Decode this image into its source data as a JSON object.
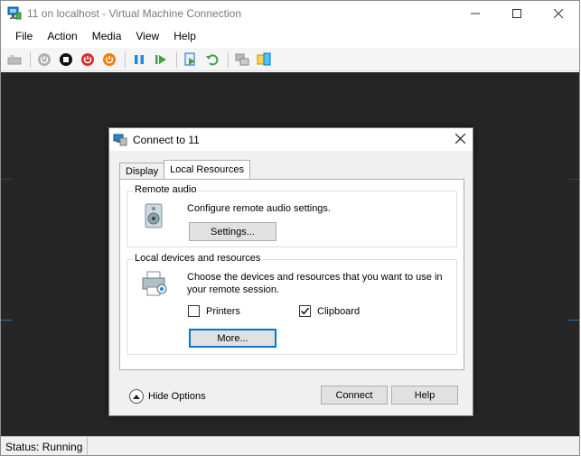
{
  "window": {
    "title": "11 on localhost - Virtual Machine Connection",
    "icon": "vm-connection-icon",
    "controls": {
      "minimize": "minimize-icon",
      "maximize": "maximize-icon",
      "close": "close-icon"
    }
  },
  "menu": {
    "items": [
      {
        "label": "File"
      },
      {
        "label": "Action"
      },
      {
        "label": "Media"
      },
      {
        "label": "View"
      },
      {
        "label": "Help"
      }
    ]
  },
  "toolbar": {
    "buttons": [
      "ctrl-alt-del-icon",
      "start-icon",
      "turn-off-icon",
      "shut-down-icon",
      "save-icon",
      "pause-icon",
      "resume-icon",
      "checkpoint-icon",
      "revert-icon",
      "enhanced-session-icon",
      "share-icon"
    ]
  },
  "status": {
    "text": "Status: Running"
  },
  "dialog": {
    "title": "Connect to 11",
    "tabs": [
      {
        "label": "Display",
        "active": false
      },
      {
        "label": "Local Resources",
        "active": true
      }
    ],
    "remote_audio": {
      "label": "Remote audio",
      "description": "Configure remote audio settings.",
      "settings_button": "Settings..."
    },
    "local_devices": {
      "label": "Local devices and resources",
      "description_line1": "Choose the devices and resources that you want to use in",
      "description_line2": "your remote session.",
      "printers": {
        "label": "Printers",
        "checked": false
      },
      "clipboard": {
        "label": "Clipboard",
        "checked": true
      },
      "more_button": "More..."
    },
    "hide_options": "Hide Options",
    "connect_button": "Connect",
    "help_button": "Help"
  }
}
